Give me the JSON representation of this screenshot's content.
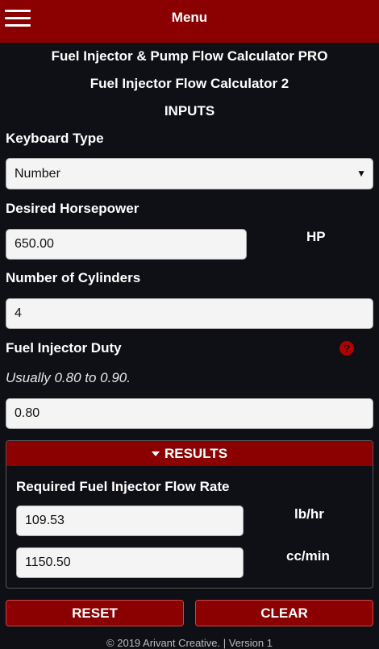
{
  "topbar": {
    "menu_label": "Menu",
    "menu_icon": "hamburger-icon"
  },
  "header": {
    "app_title": "Fuel Injector & Pump Flow Calculator PRO",
    "calc_title": "Fuel Injector Flow Calculator 2",
    "section": "INPUTS"
  },
  "inputs": {
    "keyboard_type": {
      "label": "Keyboard Type",
      "value": "Number"
    },
    "horsepower": {
      "label": "Desired Horsepower",
      "value": "650.00",
      "unit": "HP"
    },
    "cylinders": {
      "label": "Number of Cylinders",
      "value": "4"
    },
    "duty": {
      "label": "Fuel Injector Duty",
      "hint": "Usually 0.80 to 0.90.",
      "value": "0.80",
      "help_icon": "?"
    }
  },
  "results": {
    "header": "RESULTS",
    "label": "Required Fuel Injector Flow Rate",
    "lbhr": {
      "value": "109.53",
      "unit": "lb/hr"
    },
    "ccmin": {
      "value": "1150.50",
      "unit": "cc/min"
    }
  },
  "buttons": {
    "reset": "RESET",
    "clear": "CLEAR"
  },
  "footer": {
    "text": "© 2019 Arivant Creative. | Version 1"
  },
  "colors": {
    "accent": "#8b0000",
    "background": "#0f0f16"
  }
}
